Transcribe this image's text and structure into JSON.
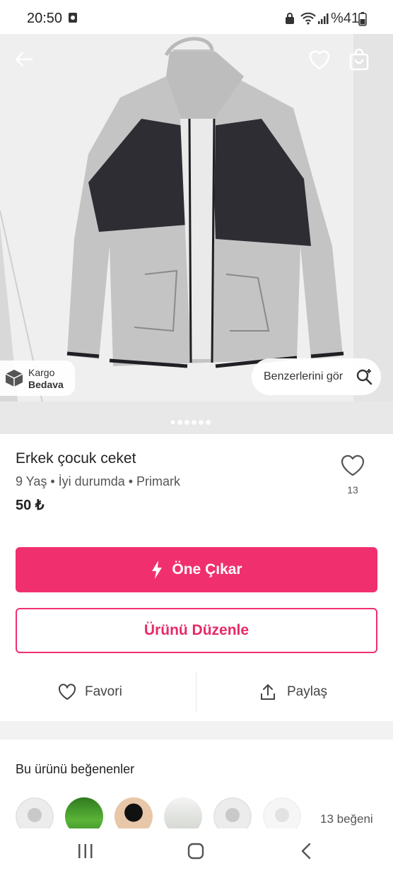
{
  "status_bar": {
    "time": "20:50",
    "battery": "%41"
  },
  "listing": {
    "cargo_line1": "Kargo",
    "cargo_line2": "Bedava",
    "similar_label": "Benzerlerini gör",
    "image_count": 6,
    "active_image": 1,
    "title": "Erkek çocuk ceket",
    "meta": "9 Yaş • İyi durumda • Primark",
    "price": "50 ₺",
    "favorite_count": "13"
  },
  "buttons": {
    "promote": "Öne Çıkar",
    "edit": "Ürünü Düzenle",
    "favorite": "Favori",
    "share": "Paylaş"
  },
  "likers": {
    "title": "Bu ürünü beğenenler",
    "count_label": "13 beğeni"
  },
  "colors": {
    "accent": "#f0306e"
  }
}
